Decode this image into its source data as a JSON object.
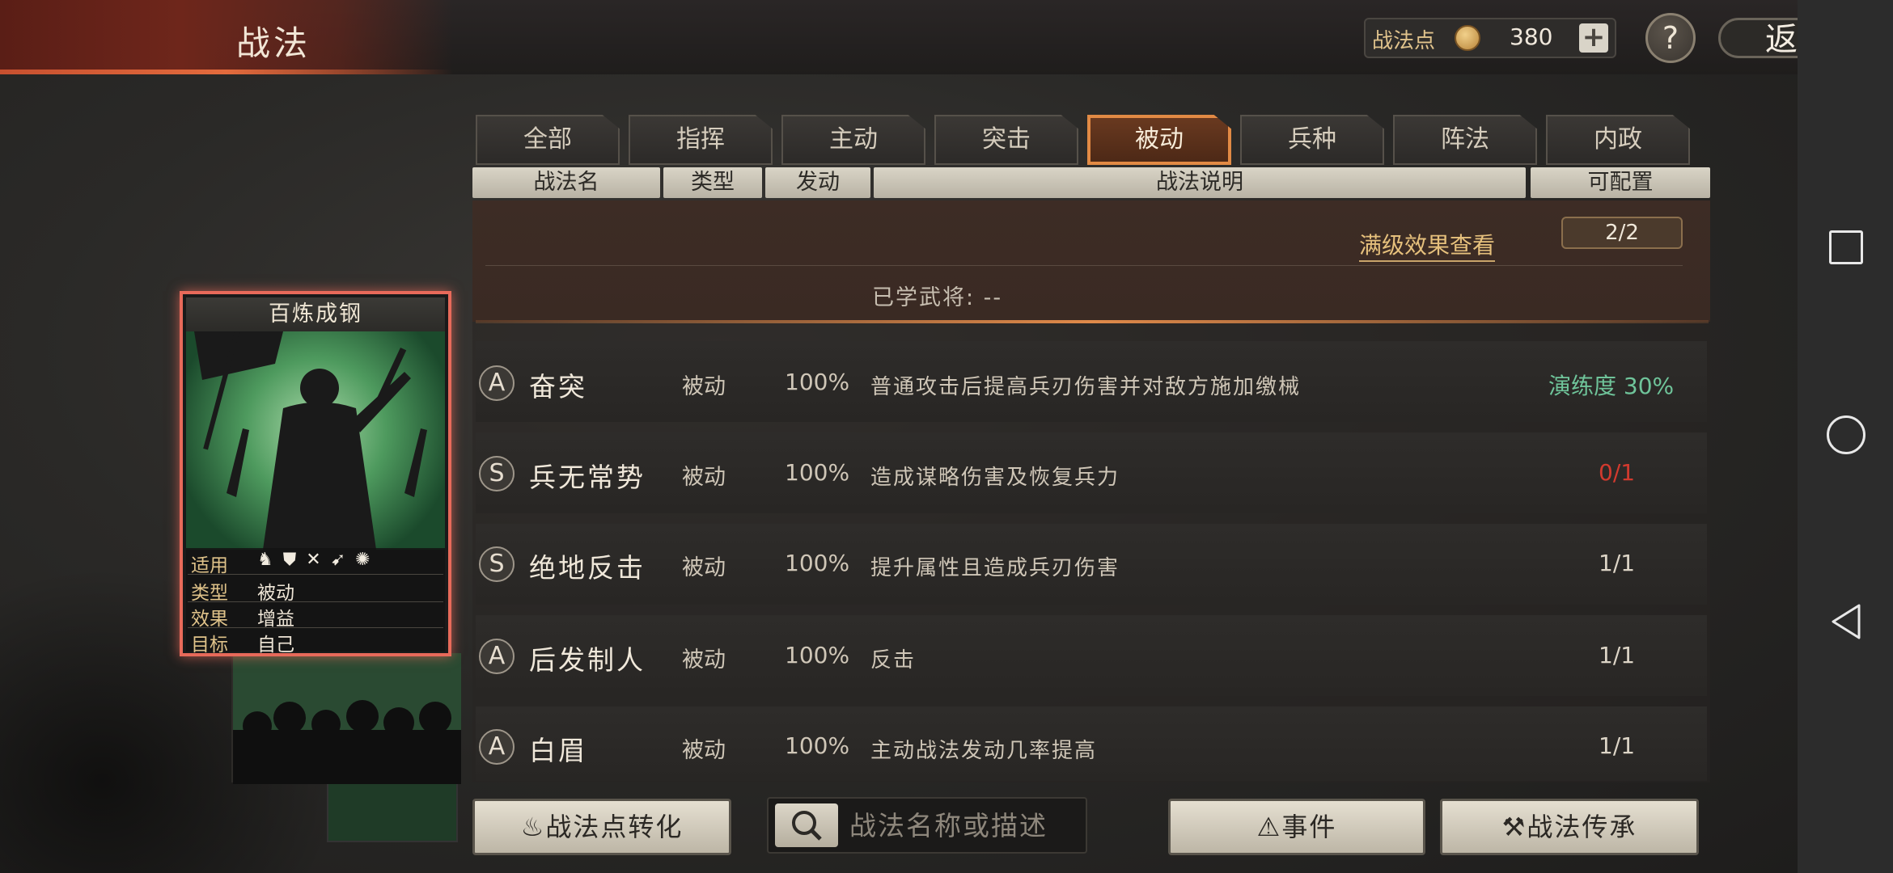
{
  "header": {
    "title": "战法",
    "points_label": "战法点",
    "points_value": "380",
    "plus_label": "+",
    "help_label": "?",
    "return_label": "返回"
  },
  "tabs": [
    {
      "label": "全部"
    },
    {
      "label": "指挥"
    },
    {
      "label": "主动"
    },
    {
      "label": "突击"
    },
    {
      "label": "被动"
    },
    {
      "label": "兵种"
    },
    {
      "label": "阵法"
    },
    {
      "label": "内政"
    }
  ],
  "active_tab": "被动",
  "columns": {
    "name": "战法名",
    "type": "类型",
    "trigger": "发动",
    "desc": "战法说明",
    "config": "可配置"
  },
  "expanded": {
    "full_level_link": "满级效果查看",
    "learned_label": "已学武将: --",
    "ratio": "2/2"
  },
  "skills": [
    {
      "grade": "A",
      "name": "奋突",
      "type": "被动",
      "rate": "100%",
      "desc": "普通攻击后提高兵刃伤害并对敌方施加缴械",
      "config": "演练度 30%",
      "config_color": "#6fc49a"
    },
    {
      "grade": "S",
      "name": "兵无常势",
      "type": "被动",
      "rate": "100%",
      "desc": "造成谋略伤害及恢复兵力",
      "config": "0/1",
      "config_color": "#d23a2e"
    },
    {
      "grade": "S",
      "name": "绝地反击",
      "type": "被动",
      "rate": "100%",
      "desc": "提升属性且造成兵刃伤害",
      "config": "1/1",
      "config_color": "#dcd4c6"
    },
    {
      "grade": "A",
      "name": "后发制人",
      "type": "被动",
      "rate": "100%",
      "desc": "反击",
      "config": "1/1",
      "config_color": "#dcd4c6"
    },
    {
      "grade": "A",
      "name": "白眉",
      "type": "被动",
      "rate": "100%",
      "desc": "主动战法发动几率提高",
      "config": "1/1",
      "config_color": "#dcd4c6"
    }
  ],
  "card": {
    "title": "百炼成钢",
    "labels": {
      "apply": "适用",
      "type": "类型",
      "effect": "效果",
      "target": "目标"
    },
    "type": "被动",
    "effect": "增益",
    "target": "自己",
    "troop_icons": [
      "cavalry-icon",
      "shield-icon",
      "archer-icon",
      "spear-icon",
      "siege-icon"
    ]
  },
  "buttons": {
    "convert": "战法点转化",
    "search_placeholder": "战法名称或描述",
    "event": "事件",
    "inherit": "战法传承"
  }
}
